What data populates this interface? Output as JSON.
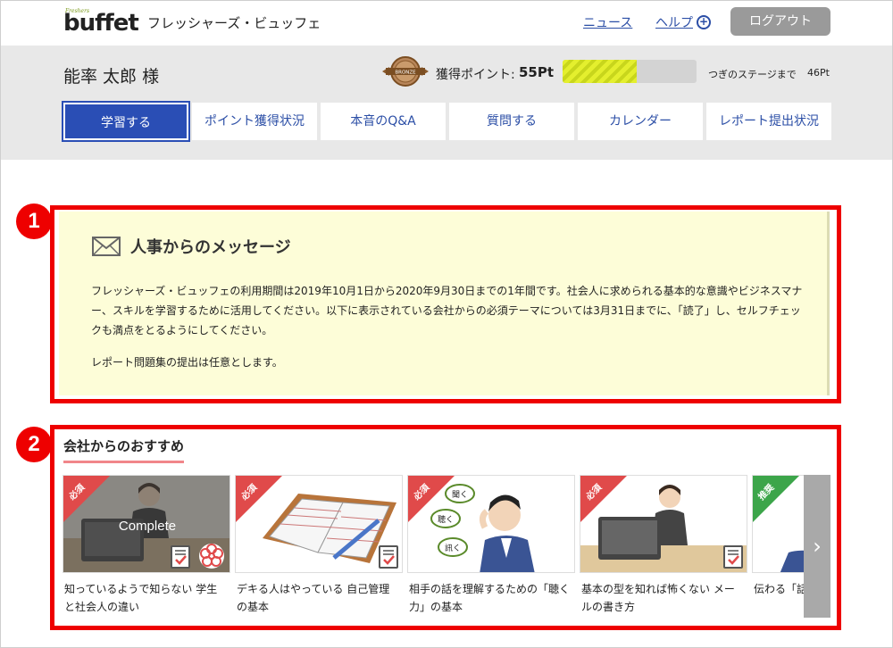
{
  "header": {
    "logo_small": "Freshers",
    "logo_text": "buffet",
    "site_title": "フレッシャーズ・ビュッフェ",
    "news_link": "ニュース",
    "help_link": "ヘルプ",
    "logout_button": "ログアウト"
  },
  "user": {
    "name": "能率 太郎 様",
    "badge_label": "BRONZE",
    "points_label": "獲得ポイント:",
    "points_value": "55Pt",
    "progress_fraction": 0.55,
    "next_stage_label": "つぎのステージまで",
    "next_stage_points": "46Pt"
  },
  "tabs": [
    {
      "label": "学習する",
      "active": true
    },
    {
      "label": "ポイント獲得状況",
      "active": false
    },
    {
      "label": "本音のQ&A",
      "active": false
    },
    {
      "label": "質問する",
      "active": false
    },
    {
      "label": "カレンダー",
      "active": false
    },
    {
      "label": "レポート提出状況",
      "active": false
    }
  ],
  "annotations": [
    "1",
    "2"
  ],
  "message": {
    "title": "人事からのメッセージ",
    "body": "フレッシャーズ・ビュッフェの利用期間は2019年10月1日から2020年9月30日までの1年間です。社会人に求められる基本的な意識やビジネスマナー、スキルを学習するために活用してください。以下に表示されている会社からの必須テーマについては3月31日までに、「読了」し、セルフチェックも満点をとるようにしてください。",
    "note": "レポート問題集の提出は任意とします。"
  },
  "recommend": {
    "title": "会社からのおすすめ",
    "complete_label": "Complete",
    "bubbles": [
      "聞く",
      "聴く",
      "訊く"
    ],
    "cards": [
      {
        "tag": "必須",
        "tag_color": "#e04a4a",
        "caption": "知っているようで知らない 学生と社会人の違い",
        "complete": true
      },
      {
        "tag": "必須",
        "tag_color": "#e04a4a",
        "caption": "デキる人はやっている 自己管理の基本",
        "complete": false
      },
      {
        "tag": "必須",
        "tag_color": "#e04a4a",
        "caption": "相手の話を理解するための「聴く力」の基本",
        "complete": false
      },
      {
        "tag": "必須",
        "tag_color": "#e04a4a",
        "caption": "基本の型を知れば怖くない メールの書き方",
        "complete": false
      },
      {
        "tag": "推奨",
        "tag_color": "#3ca54a",
        "caption": "伝わる「話立て方」",
        "complete": false
      }
    ],
    "next_arrow": "›"
  }
}
